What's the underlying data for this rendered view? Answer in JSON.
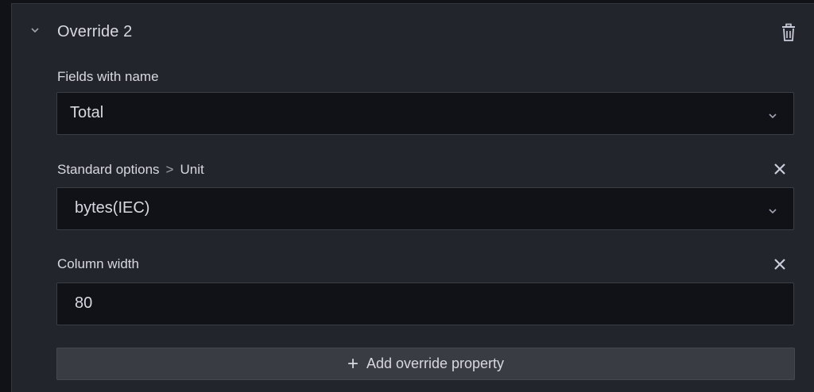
{
  "override": {
    "title": "Override 2",
    "collapse_icon": "chevron-down-icon",
    "delete_icon": "trash-icon"
  },
  "matcher": {
    "label": "Fields with name",
    "value": "Total",
    "icon": "chevron-down-icon"
  },
  "unit_property": {
    "label_category": "Standard options",
    "label_separator": ">",
    "label_name": "Unit",
    "value": "bytes(IEC)",
    "remove_icon": "close-icon"
  },
  "width_property": {
    "label": "Column width",
    "value": "80",
    "remove_icon": "close-icon"
  },
  "add_button": {
    "plus": "+",
    "label": "Add override property"
  }
}
